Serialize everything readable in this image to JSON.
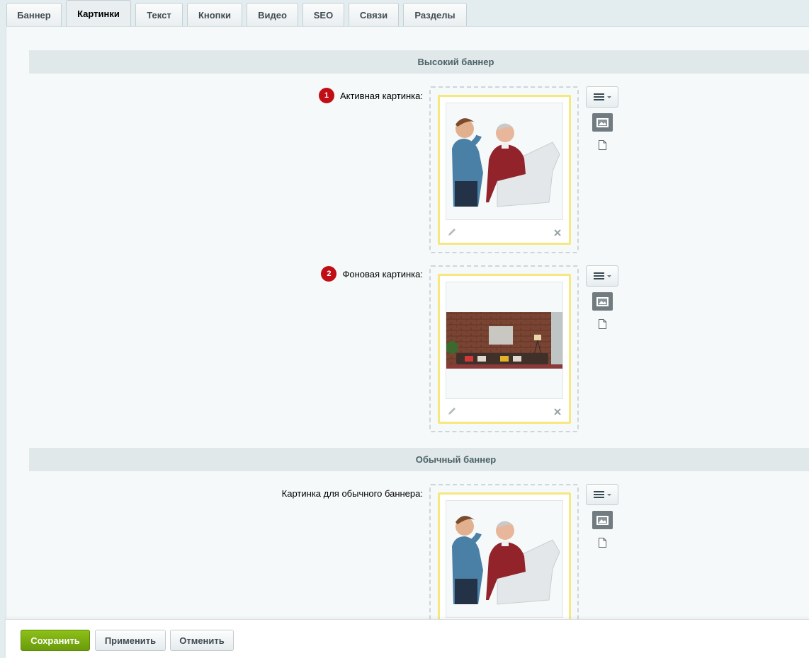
{
  "tabs": [
    "Баннер",
    "Картинки",
    "Текст",
    "Кнопки",
    "Видео",
    "SEO",
    "Связи",
    "Разделы"
  ],
  "active_tab": "Картинки",
  "sections": [
    {
      "title": "Высокий баннер"
    },
    {
      "title": "Обычный баннер"
    }
  ],
  "fields": [
    {
      "badge": "1",
      "label": "Активная картинка:",
      "image": "people-photo"
    },
    {
      "badge": "2",
      "label": "Фоновая картинка:",
      "image": "interior-photo"
    },
    {
      "badge": "",
      "label": "Картинка для обычного баннера:",
      "image": "people-photo"
    }
  ],
  "footer": {
    "save": "Сохранить",
    "apply": "Применить",
    "cancel": "Отменить"
  },
  "colors": {
    "badge": "#c10d16",
    "save_button": "#7aab10",
    "preview_border": "#f6e77e"
  }
}
